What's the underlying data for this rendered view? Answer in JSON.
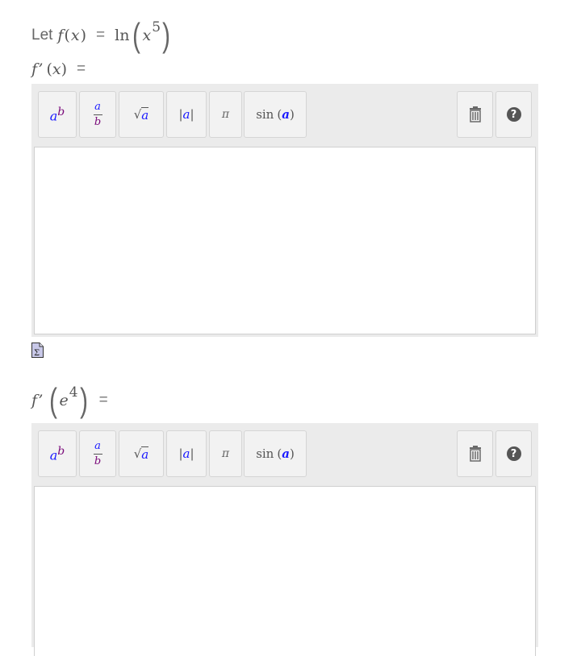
{
  "question1": {
    "let_label": "Let",
    "func": "f",
    "var": "x",
    "eq": "=",
    "ln": "ln",
    "base": "x",
    "exponent": "5"
  },
  "answer1_prompt": {
    "func": "f’",
    "var": "x",
    "eq": "="
  },
  "answer2_prompt": {
    "func": "f’",
    "base": "e",
    "exponent": "4",
    "eq": "="
  },
  "toolbar": {
    "power": {
      "base": "a",
      "exp": "b"
    },
    "fraction": {
      "num": "a",
      "den": "b"
    },
    "sqrt": {
      "symbol": "√",
      "arg": "a"
    },
    "abs": {
      "left": "|",
      "arg": "a",
      "right": "|"
    },
    "pi": "π",
    "sin": {
      "name": "sin",
      "open": "(",
      "arg": "a",
      "close": ")"
    },
    "help": "?"
  },
  "editor1": {
    "value": ""
  },
  "editor2": {
    "value": ""
  }
}
